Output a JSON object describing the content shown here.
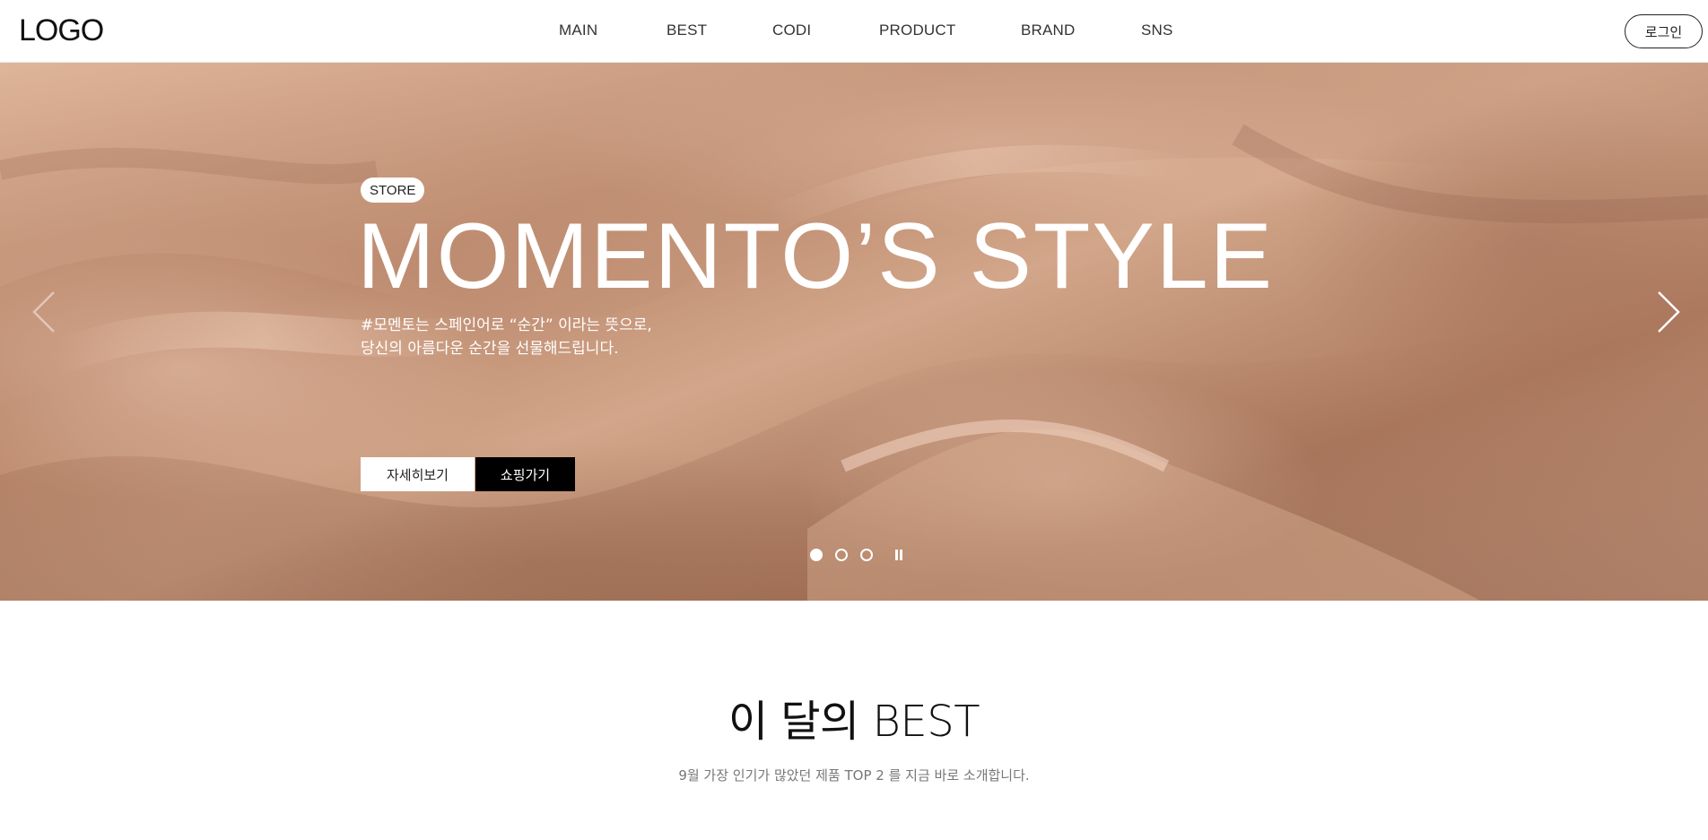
{
  "header": {
    "logo": "LOGO",
    "nav": [
      "MAIN",
      "BEST",
      "CODI",
      "PRODUCT",
      "BRAND",
      "SNS"
    ],
    "login_label": "로그인"
  },
  "hero": {
    "badge": "STORE",
    "title": "MOMENTO’S STYLE",
    "desc_lines": [
      "#모멘토는 스페인어로 “순간” 이라는 뜻으로,",
      "당신의 아름다운 순간을 선물해드립니다."
    ],
    "detail_button": "자세히보기",
    "shop_button": "쇼핑가기",
    "prev_icon": "chevron-left-icon",
    "next_icon": "chevron-right-icon",
    "slides_total": 3,
    "slide_active": 1,
    "pause_icon": "pause-icon"
  },
  "best": {
    "title": "이 달의 BEST",
    "subtitle": "9월 가장 인기가 많았던 제품 TOP 2 를 지금 바로 소개합니다."
  },
  "colors": {
    "hero_base": "#c08f74",
    "shop_button_bg": "#000000",
    "text_dark": "#111111",
    "text_sub": "#777777"
  }
}
